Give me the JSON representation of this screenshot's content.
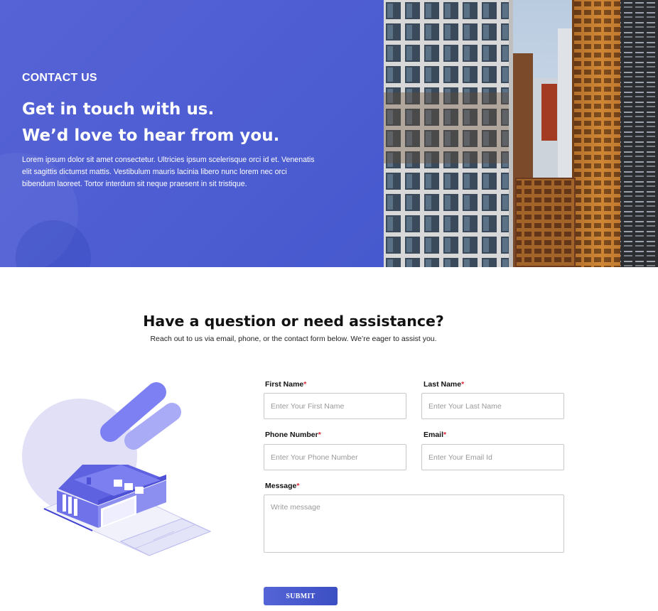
{
  "hero": {
    "eyebrow": "CONTACT US",
    "title_line1": "Get in touch with us.",
    "title_line2": "We’d love to hear from you.",
    "description": "Lorem ipsum dolor sit amet consectetur. Ultricies ipsum scelerisque orci id et. Venenatis elit sagittis dictumst mattis. Vestibulum mauris lacinia libero nunc lorem nec orci bibendum laoreet. Tortor interdum sit neque praesent in sit tristique."
  },
  "section": {
    "title": "Have a question or need assistance?",
    "subtitle": "Reach out to us via email, phone, or the contact form below. We’re eager to assist you."
  },
  "form": {
    "first_name": {
      "label": "First Name",
      "required_mark": "*",
      "placeholder": "Enter Your First Name",
      "value": ""
    },
    "last_name": {
      "label": "Last Name",
      "required_mark": "*",
      "placeholder": "Enter Your Last Name",
      "value": ""
    },
    "phone": {
      "label": "Phone Number",
      "required_mark": "*",
      "placeholder": "Enter Your Phone Number",
      "value": ""
    },
    "email": {
      "label": "Email",
      "required_mark": "*",
      "placeholder": "Enter Your Email Id",
      "value": ""
    },
    "message": {
      "label": "Message",
      "required_mark": "*",
      "placeholder": "Write message",
      "value": ""
    },
    "submit_label": "SUBMIT"
  },
  "colors": {
    "brand_blue": "#4a5bd0",
    "required_red": "#e0283a",
    "illustration_purple": "#7b7ff0"
  },
  "icons": {
    "hero_image": "city-buildings-photo",
    "illustration": "isometric-house-illustration"
  }
}
